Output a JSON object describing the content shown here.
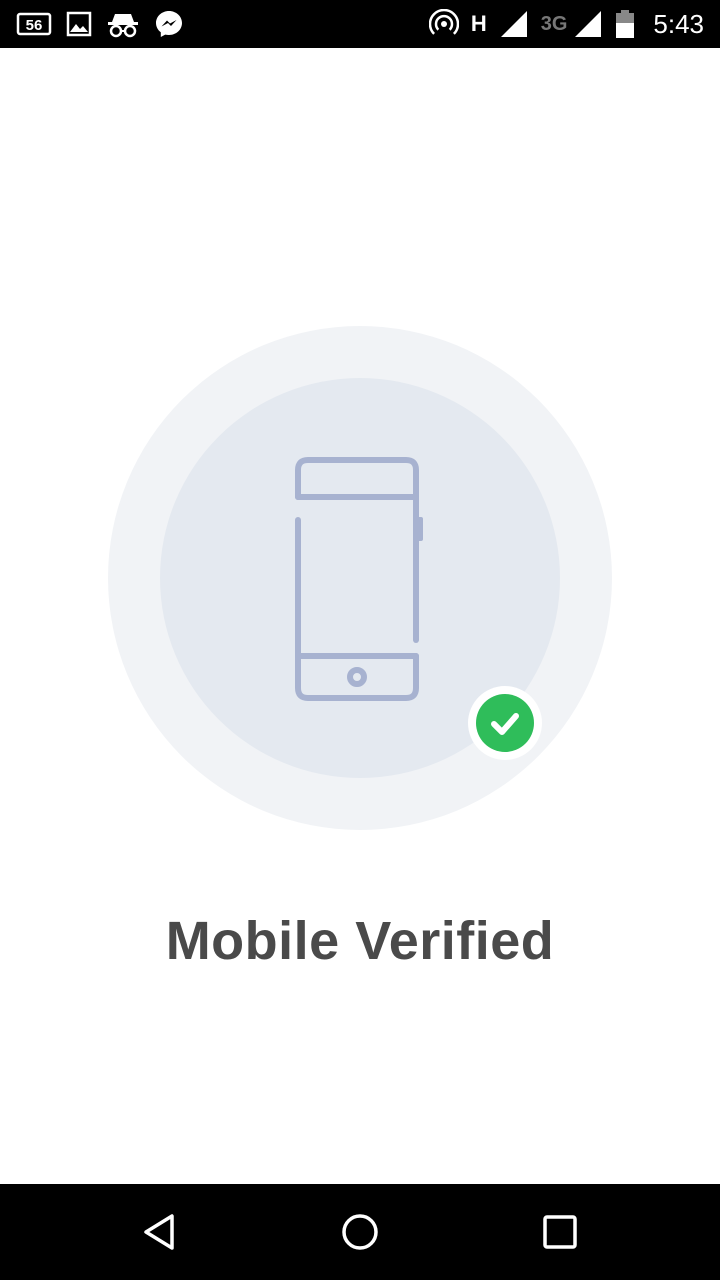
{
  "status_bar": {
    "left_icons": [
      "badge-56-icon",
      "image-icon",
      "incognito-icon",
      "messenger-icon"
    ],
    "badge_text": "56",
    "right_icons": [
      "hotspot-icon",
      "signal-h-icon",
      "signal-3g-icon",
      "battery-icon"
    ],
    "network_h": "H",
    "network_3g": "3G",
    "time": "5:43"
  },
  "verification": {
    "title": "Mobile Verified",
    "illustration_icon": "smartphone-icon",
    "badge_icon": "check-icon",
    "colors": {
      "outer_ring": "#f1f3f6",
      "inner_ring": "#e4e9f0",
      "phone_stroke": "#a7b2d0",
      "success": "#2fbd5a",
      "title_text": "#4a4a4a"
    }
  },
  "nav_bar": {
    "back_icon": "back-triangle-icon",
    "home_icon": "home-circle-icon",
    "recents_icon": "recents-square-icon"
  }
}
